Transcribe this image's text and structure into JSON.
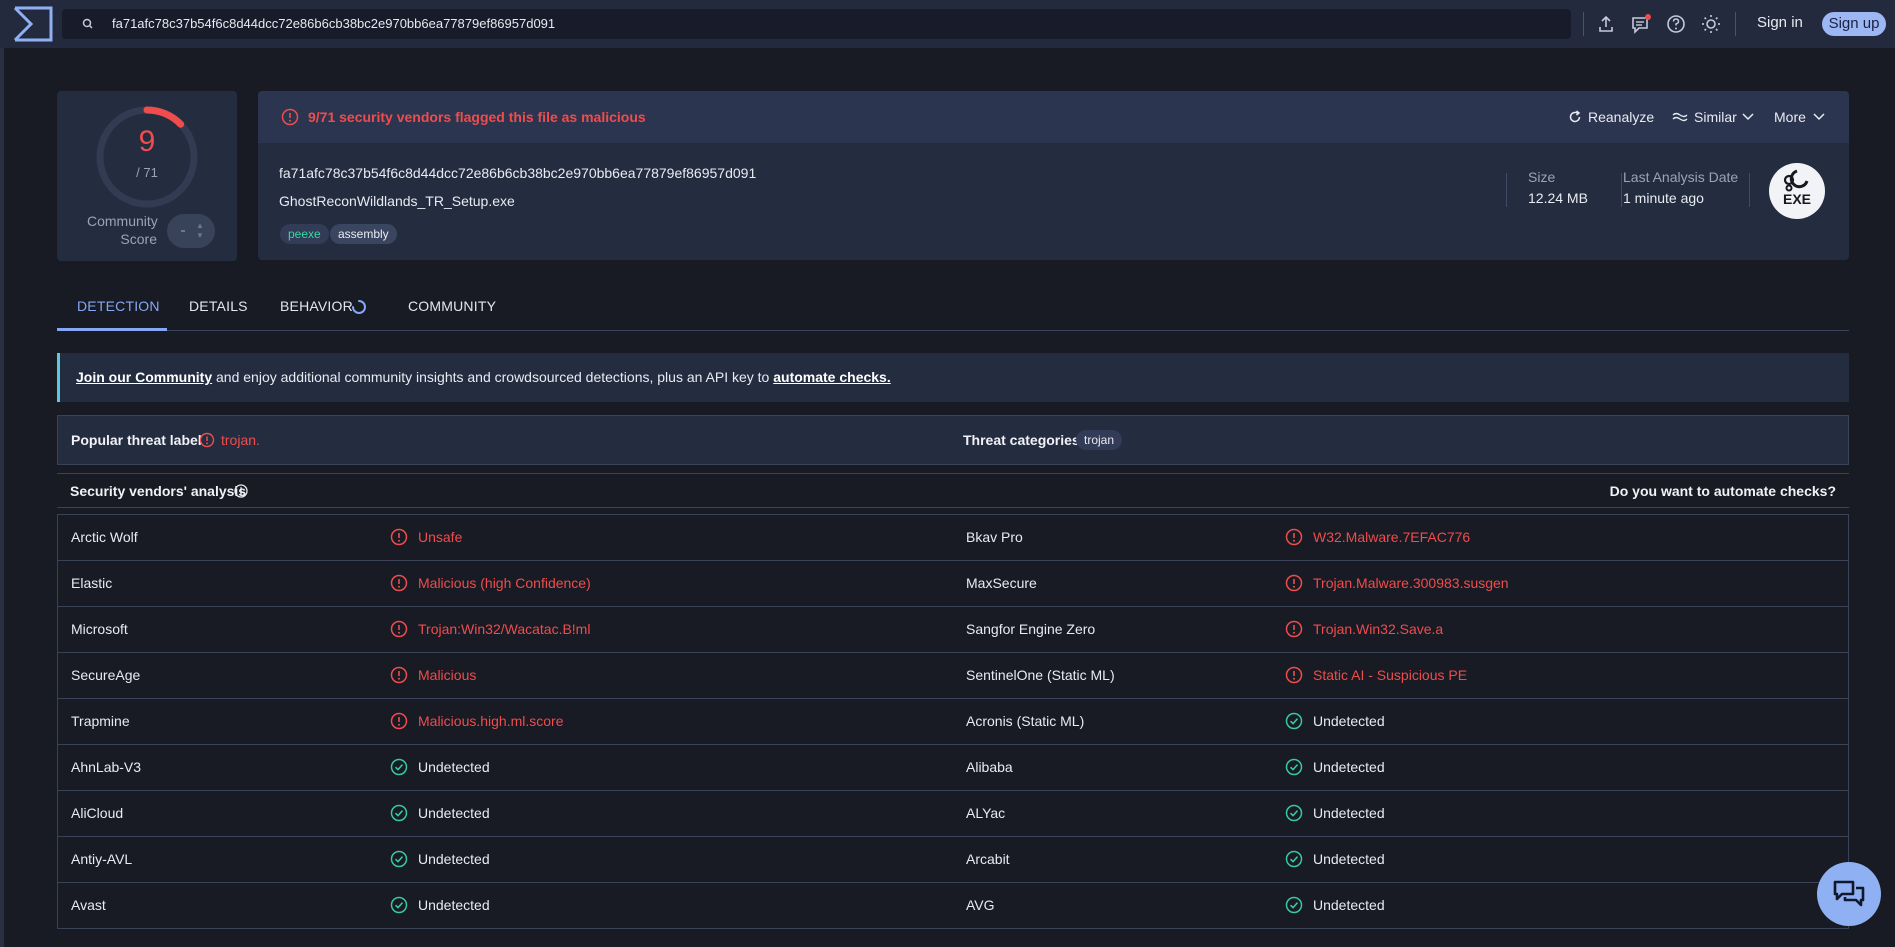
{
  "topbar": {
    "search_value": "fa71afc78c37b54f6c8d44dcc72e86b6cb38bc2e970bb6ea77879ef86957d091",
    "sign_in": "Sign in",
    "sign_up": "Sign up",
    "icons": [
      "upload-icon",
      "chat-notification-icon",
      "help-icon",
      "theme-icon"
    ]
  },
  "score": {
    "detections": "9",
    "total": "/ 71",
    "detection_ratio": 0.1268,
    "community_label_1": "Community",
    "community_label_2": "Score",
    "community_value": "-"
  },
  "header": {
    "flag_text": "9/71 security vendors flagged this file as malicious",
    "actions": {
      "reanalyze": "Reanalyze",
      "similar": "Similar",
      "more": "More"
    },
    "hash": "fa71afc78c37b54f6c8d44dcc72e86b6cb38bc2e970bb6ea77879ef86957d091",
    "filename": "GhostReconWildlands_TR_Setup.exe",
    "tags": [
      "peexe",
      "assembly"
    ],
    "size_label": "Size",
    "size_value": "12.24 MB",
    "date_label": "Last Analysis Date",
    "date_value": "1 minute ago",
    "badge": "EXE"
  },
  "tabs": [
    "DETECTION",
    "DETAILS",
    "BEHAVIOR",
    "COMMUNITY"
  ],
  "banner": {
    "link1": "Join our Community",
    "middle": " and enjoy additional community insights and crowdsourced detections, plus an API key to ",
    "link2": "automate checks."
  },
  "threat": {
    "popular_label": "Popular threat label",
    "popular_value": "trojan.",
    "categories_label": "Threat categories",
    "categories_value": "trojan"
  },
  "vendors": {
    "title": "Security vendors' analysis",
    "automate": "Do you want to automate checks?",
    "rows": [
      [
        {
          "name": "Arctic Wolf",
          "result": "Unsafe",
          "status": "bad"
        },
        {
          "name": "Bkav Pro",
          "result": "W32.Malware.7EFAC776",
          "status": "bad"
        }
      ],
      [
        {
          "name": "Elastic",
          "result": "Malicious (high Confidence)",
          "status": "bad"
        },
        {
          "name": "MaxSecure",
          "result": "Trojan.Malware.300983.susgen",
          "status": "bad"
        }
      ],
      [
        {
          "name": "Microsoft",
          "result": "Trojan:Win32/Wacatac.B!ml",
          "status": "bad"
        },
        {
          "name": "Sangfor Engine Zero",
          "result": "Trojan.Win32.Save.a",
          "status": "bad"
        }
      ],
      [
        {
          "name": "SecureAge",
          "result": "Malicious",
          "status": "bad"
        },
        {
          "name": "SentinelOne (Static ML)",
          "result": "Static AI - Suspicious PE",
          "status": "bad"
        }
      ],
      [
        {
          "name": "Trapmine",
          "result": "Malicious.high.ml.score",
          "status": "bad"
        },
        {
          "name": "Acronis (Static ML)",
          "result": "Undetected",
          "status": "ok"
        }
      ],
      [
        {
          "name": "AhnLab-V3",
          "result": "Undetected",
          "status": "ok"
        },
        {
          "name": "Alibaba",
          "result": "Undetected",
          "status": "ok"
        }
      ],
      [
        {
          "name": "AliCloud",
          "result": "Undetected",
          "status": "ok"
        },
        {
          "name": "ALYac",
          "result": "Undetected",
          "status": "ok"
        }
      ],
      [
        {
          "name": "Antiy-AVL",
          "result": "Undetected",
          "status": "ok"
        },
        {
          "name": "Arcabit",
          "result": "Undetected",
          "status": "ok"
        }
      ],
      [
        {
          "name": "Avast",
          "result": "Undetected",
          "status": "ok"
        },
        {
          "name": "AVG",
          "result": "Undetected",
          "status": "ok"
        }
      ]
    ]
  },
  "colors": {
    "malicious": "#ef4d4d",
    "undetected": "#38c9a0",
    "accent": "#86a7f5",
    "background": "#181a24",
    "card": "#242c40"
  }
}
